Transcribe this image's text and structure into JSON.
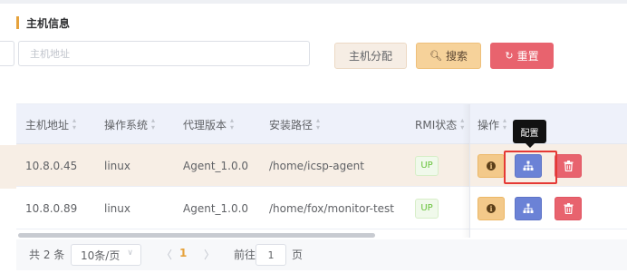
{
  "section": {
    "title": "主机信息"
  },
  "search": {
    "placeholder": "主机地址",
    "value": ""
  },
  "toolbar": {
    "assign_label": "主机分配",
    "search_label": "搜索",
    "reset_label": "重置"
  },
  "table": {
    "columns": [
      "主机地址",
      "操作系统",
      "代理版本",
      "安装路径",
      "RMI状态",
      "操作"
    ],
    "rows": [
      {
        "address": "10.8.0.45",
        "os": "linux",
        "agent": "Agent_1.0.0",
        "path": "/home/icsp-agent",
        "rmi": "UP"
      },
      {
        "address": "10.8.0.89",
        "os": "linux",
        "agent": "Agent_1.0.0",
        "path": "/home/fox/monitor-test",
        "rmi": "UP"
      }
    ]
  },
  "tooltip": {
    "text": "配置"
  },
  "pagination": {
    "total_text": "共 2 条",
    "page_size": "10条/页",
    "current_page": "1",
    "jump_label": "前往",
    "jump_value": "1",
    "jump_suffix": "页"
  },
  "colors": {
    "accent": "#e6a23c",
    "config": "#6b82d6",
    "danger": "#e8636e",
    "success": "#67c23a"
  }
}
